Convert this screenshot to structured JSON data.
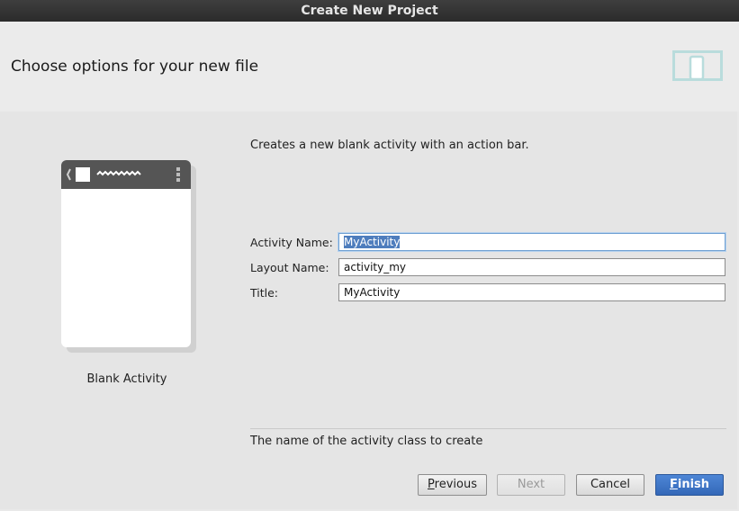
{
  "window": {
    "title": "Create New Project"
  },
  "header": {
    "title": "Choose options for your new file",
    "icon": "device-icon"
  },
  "template": {
    "name": "Blank Activity"
  },
  "description": "Creates a new blank activity with an action bar.",
  "form": {
    "activity_name_label": "Activity Name:",
    "activity_name_value": "MyActivity",
    "layout_name_label": "Layout Name:",
    "layout_name_value": "activity_my",
    "title_label": "Title:",
    "title_value": "MyActivity"
  },
  "hint": "The name of the activity class to create",
  "buttons": {
    "previous_mnemonic": "P",
    "previous_rest": "revious",
    "next": "Next",
    "cancel": "Cancel",
    "finish_mnemonic": "F",
    "finish_rest": "inish"
  },
  "colors": {
    "titlebar": "#333333",
    "accent": "#3d74c4",
    "selection": "#4e7dbd",
    "icon_teal": "#b9dcdc"
  }
}
